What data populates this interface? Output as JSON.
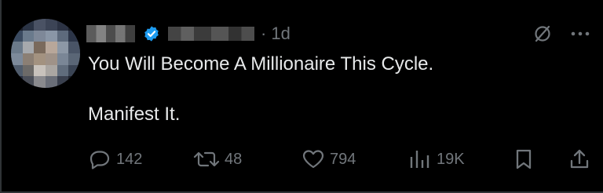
{
  "post": {
    "time": "1d",
    "separator": "·",
    "text_line1": "You Will Become A Millionaire This Cycle.",
    "text_line2": "Manifest It."
  },
  "actions": {
    "replies": "142",
    "reposts": "48",
    "likes": "794",
    "views": "19K"
  },
  "icons": {
    "verified": "verified-badge-icon",
    "grok": "slashed-circle-icon",
    "more": "more-horizontal-icon",
    "reply": "reply-icon",
    "repost": "repost-icon",
    "like": "heart-icon",
    "views": "views-icon",
    "bookmark": "bookmark-icon",
    "share": "share-icon"
  },
  "colors": {
    "background": "#000000",
    "text": "#e7e9ea",
    "secondary": "#71767b",
    "verified": "#1d9bf0"
  }
}
